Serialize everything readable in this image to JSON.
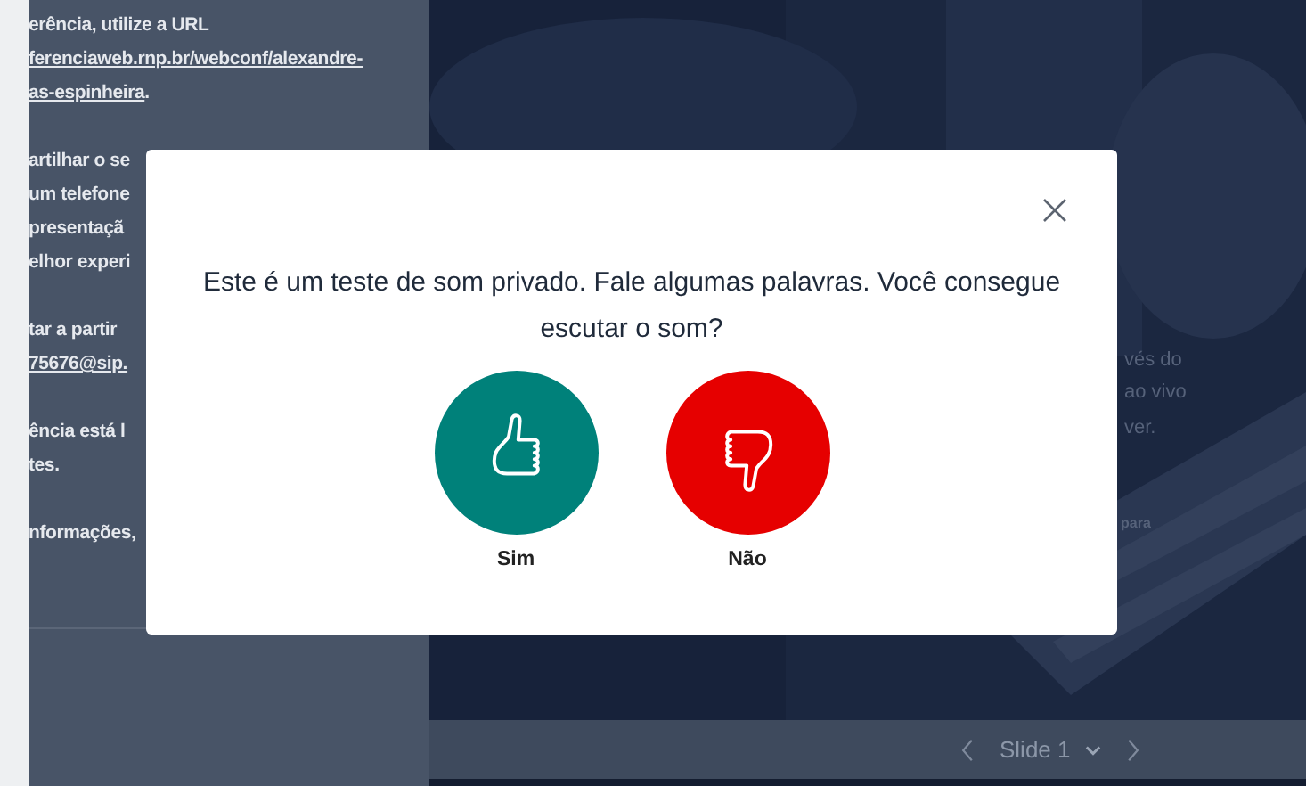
{
  "sidebar": {
    "paragraphs": [
      [
        [
          {
            "text": "erência, utilize a URL",
            "kind": "text"
          }
        ],
        [
          {
            "text": "ferenciaweb.rnp.br/webconf/alexandre-",
            "kind": "link"
          }
        ],
        [
          {
            "text": "as-espinheira",
            "kind": "link"
          },
          {
            "text": ".",
            "kind": "text"
          }
        ]
      ],
      [
        [
          {
            "text": "artilhar o se",
            "kind": "text"
          }
        ],
        [
          {
            "text": "um telefone",
            "kind": "text"
          }
        ],
        [
          {
            "text": "presentaçã",
            "kind": "text"
          }
        ],
        [
          {
            "text": "elhor experi",
            "kind": "text"
          }
        ]
      ],
      [
        [
          {
            "text": "tar a partir",
            "kind": "text"
          }
        ],
        [
          {
            "text": "75676@sip.",
            "kind": "link"
          }
        ]
      ],
      [
        [
          {
            "text": "ência está l",
            "kind": "text"
          }
        ],
        [
          {
            "text": "tes.",
            "kind": "text"
          }
        ]
      ],
      [
        [
          {
            "text": "nformações,",
            "kind": "text"
          }
        ]
      ]
    ]
  },
  "slide": {
    "texts": [
      "vés do",
      "ao vivo",
      "ver.",
      "para"
    ]
  },
  "pager": {
    "label": "Slide 1"
  },
  "modal": {
    "message": "Este é um teste de som privado. Fale algumas palavras. Você consegue escutar o som?",
    "options": [
      {
        "label": "Sim",
        "kind": "yes",
        "color": "#00817a"
      },
      {
        "label": "Não",
        "kind": "no",
        "color": "#e60000"
      }
    ]
  }
}
